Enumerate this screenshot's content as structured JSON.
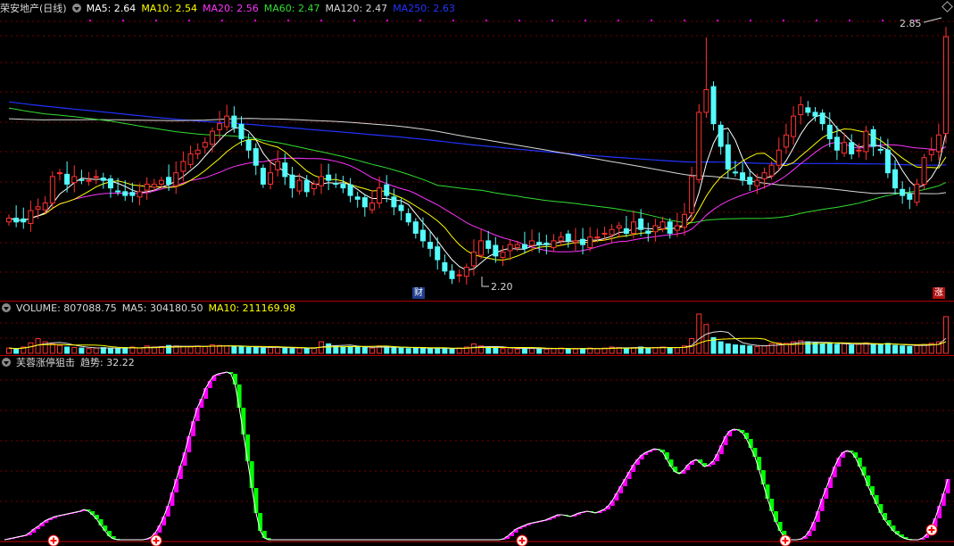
{
  "main": {
    "title": "荣安地产(日线)",
    "ma": [
      {
        "label": "MA5: 2.64",
        "color": "#ffffff"
      },
      {
        "label": "MA10: 2.54",
        "color": "#ffff00"
      },
      {
        "label": "MA20: 2.56",
        "color": "#ff33ff"
      },
      {
        "label": "MA60: 2.47",
        "color": "#33dd33"
      },
      {
        "label": "MA120: 2.47",
        "color": "#d8d8d8"
      },
      {
        "label": "MA250: 2.63",
        "color": "#2233ff"
      }
    ],
    "high_label": "2.85",
    "low_label": "2.20",
    "marker_cai": "财",
    "marker_zhang": "涨"
  },
  "volume": {
    "label": "VOLUME: 807088.75",
    "ma5": "MA5: 304180.50",
    "ma10": "MA10: 211169.98",
    "colors": {
      "label": "#d8d8d8",
      "ma5": "#d8d8d8",
      "ma10": "#ffff00"
    }
  },
  "indicator": {
    "title": "芙蓉涨停狙击",
    "trend": "趋势: 32.22",
    "colors": {
      "title": "#d8d8d8",
      "trend": "#d8d8d8"
    }
  },
  "colors": {
    "up": "#ff3232",
    "down": "#54fcfc",
    "grid": "#7a0000",
    "rise": "#ff00ff",
    "fall": "#00ff00"
  },
  "chart_data": {
    "type": "candlestick",
    "price_range": [
      2.18,
      2.9
    ],
    "ma_last": {
      "MA5": 2.64,
      "MA10": 2.54,
      "MA20": 2.56,
      "MA60": 2.47,
      "MA120": 2.47,
      "MA250": 2.63
    },
    "close": [
      2.37,
      2.36,
      2.36,
      2.39,
      2.4,
      2.41,
      2.48,
      2.49,
      2.46,
      2.48,
      2.47,
      2.47,
      2.48,
      2.47,
      2.45,
      2.44,
      2.43,
      2.43,
      2.44,
      2.46,
      2.46,
      2.47,
      2.46,
      2.49,
      2.52,
      2.54,
      2.55,
      2.57,
      2.6,
      2.62,
      2.64,
      2.61,
      2.58,
      2.55,
      2.51,
      2.46,
      2.49,
      2.52,
      2.48,
      2.45,
      2.47,
      2.44,
      2.46,
      2.48,
      2.47,
      2.46,
      2.45,
      2.43,
      2.42,
      2.4,
      2.41,
      2.45,
      2.43,
      2.4,
      2.39,
      2.36,
      2.33,
      2.31,
      2.29,
      2.26,
      2.23,
      2.21,
      2.22,
      2.24,
      2.28,
      2.31,
      2.29,
      2.27,
      2.28,
      2.3,
      2.3,
      2.29,
      2.31,
      2.3,
      2.3,
      2.31,
      2.32,
      2.31,
      2.31,
      2.3,
      2.32,
      2.32,
      2.33,
      2.34,
      2.35,
      2.33,
      2.36,
      2.34,
      2.33,
      2.35,
      2.36,
      2.33,
      2.35,
      2.38,
      2.48,
      2.65,
      2.71,
      2.62,
      2.56,
      2.5,
      2.49,
      2.47,
      2.46,
      2.47,
      2.49,
      2.51,
      2.55,
      2.59,
      2.64,
      2.67,
      2.65,
      2.64,
      2.62,
      2.58,
      2.55,
      2.57,
      2.54,
      2.55,
      2.6,
      2.56,
      2.55,
      2.49,
      2.45,
      2.43,
      2.42,
      2.46,
      2.53,
      2.55,
      2.59,
      2.85
    ],
    "volume": [
      0.1,
      0.08,
      0.12,
      0.2,
      0.28,
      0.22,
      0.18,
      0.15,
      0.12,
      0.11,
      0.1,
      0.09,
      0.1,
      0.11,
      0.1,
      0.09,
      0.11,
      0.12,
      0.1,
      0.14,
      0.12,
      0.13,
      0.15,
      0.14,
      0.13,
      0.12,
      0.14,
      0.13,
      0.16,
      0.15,
      0.14,
      0.13,
      0.12,
      0.11,
      0.12,
      0.1,
      0.11,
      0.12,
      0.1,
      0.09,
      0.1,
      0.09,
      0.1,
      0.22,
      0.18,
      0.14,
      0.12,
      0.13,
      0.12,
      0.11,
      0.1,
      0.14,
      0.12,
      0.11,
      0.1,
      0.09,
      0.11,
      0.1,
      0.09,
      0.1,
      0.09,
      0.08,
      0.1,
      0.12,
      0.18,
      0.14,
      0.1,
      0.11,
      0.09,
      0.1,
      0.08,
      0.09,
      0.1,
      0.09,
      0.08,
      0.09,
      0.1,
      0.09,
      0.08,
      0.09,
      0.1,
      0.09,
      0.1,
      0.12,
      0.11,
      0.1,
      0.11,
      0.12,
      0.1,
      0.11,
      0.12,
      0.1,
      0.11,
      0.14,
      0.28,
      0.75,
      0.55,
      0.3,
      0.22,
      0.18,
      0.16,
      0.15,
      0.14,
      0.13,
      0.14,
      0.18,
      0.2,
      0.19,
      0.22,
      0.24,
      0.22,
      0.2,
      0.18,
      0.19,
      0.17,
      0.18,
      0.16,
      0.17,
      0.2,
      0.18,
      0.17,
      0.19,
      0.15,
      0.14,
      0.13,
      0.15,
      0.17,
      0.19,
      0.22,
      0.7
    ],
    "trend": [
      2,
      3,
      4,
      5,
      6,
      7,
      10,
      14,
      17,
      21,
      24,
      26,
      28,
      29,
      30,
      31,
      32,
      33,
      34,
      36,
      34,
      30,
      25,
      18,
      12,
      6,
      3,
      2,
      2,
      2,
      2,
      2,
      2,
      2,
      3,
      5,
      10,
      18,
      28,
      40,
      55,
      70,
      85,
      100,
      118,
      135,
      150,
      160,
      172,
      180,
      186,
      188,
      189,
      190,
      188,
      176,
      150,
      120,
      90,
      60,
      32,
      12,
      4,
      2,
      2,
      2,
      2,
      2,
      2,
      2,
      2,
      2,
      2,
      2,
      2,
      2,
      2,
      2,
      2,
      2,
      2,
      2,
      2,
      2,
      2,
      2,
      2,
      2,
      2,
      2,
      2,
      2,
      2,
      2,
      2,
      2,
      2,
      2,
      2,
      2,
      2,
      2,
      2,
      2,
      2,
      2,
      2,
      2,
      2,
      2,
      2,
      2,
      2,
      2,
      2,
      2,
      2,
      2,
      2,
      3,
      6,
      10,
      14,
      16,
      18,
      20,
      21,
      22,
      23,
      24,
      26,
      28,
      30,
      30,
      29,
      28,
      30,
      32,
      33,
      34,
      33,
      32,
      34,
      36,
      40,
      46,
      54,
      62,
      70,
      78,
      86,
      92,
      97,
      100,
      102,
      104,
      103,
      100,
      92,
      84,
      78,
      76,
      80,
      86,
      90,
      92,
      88,
      84,
      86,
      90,
      98,
      108,
      118,
      124,
      126,
      125,
      122,
      115,
      105,
      95,
      80,
      64,
      48,
      34,
      22,
      12,
      5,
      2,
      2,
      2,
      3,
      6,
      12,
      22,
      34,
      48,
      60,
      72,
      84,
      94,
      100,
      102,
      100,
      94,
      84,
      74,
      62,
      52,
      42,
      32,
      24,
      18,
      12,
      8,
      5,
      3,
      2,
      2,
      2,
      4,
      8,
      16,
      26,
      40,
      54,
      70
    ]
  }
}
